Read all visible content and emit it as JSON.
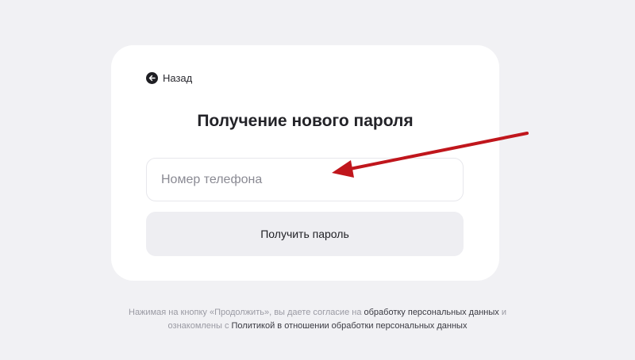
{
  "header": {
    "back_label": "Назад",
    "title": "Получение нового пароля"
  },
  "form": {
    "phone_placeholder": "Номер телефона",
    "phone_value": "",
    "submit_label": "Получить пароль"
  },
  "consent": {
    "text_1": "Нажимая на кнопку «Продолжить», вы даете согласие на",
    "link_1": "обработку персональных данных",
    "text_2": "и",
    "text_3": "ознакомлены с",
    "link_2": "Политикой в отношении обработки персональных данных"
  },
  "icons": {
    "back": "arrow-left-circle-icon",
    "annotation": "red-arrow-pointer"
  },
  "colors": {
    "background": "#f1f1f4",
    "card": "#ffffff",
    "button": "#eeeef2",
    "annotation_arrow": "#c0161c"
  }
}
